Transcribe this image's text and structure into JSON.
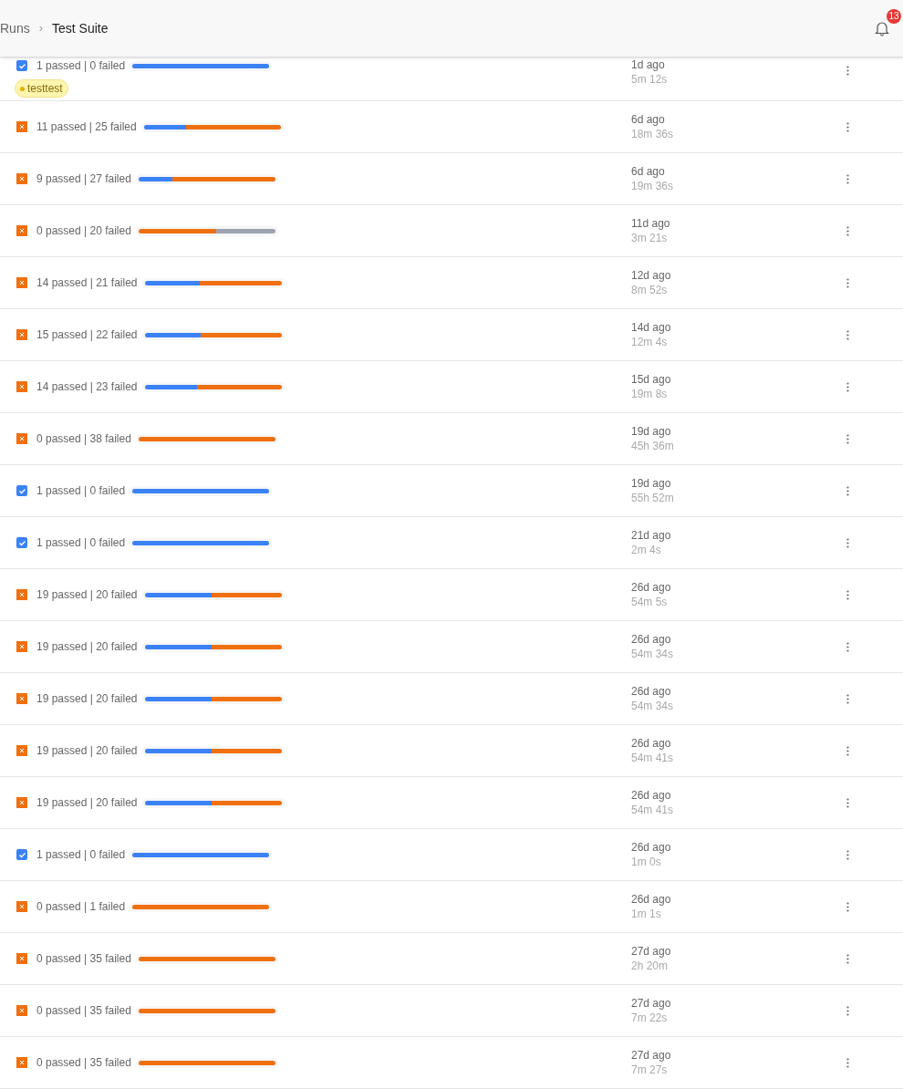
{
  "breadcrumb": {
    "parent": "Runs",
    "separator": "›",
    "current": "Test Suite"
  },
  "notifications": {
    "count": "13"
  },
  "runs": [
    {
      "passed": true,
      "summary": "1 passed | 0 failed",
      "bar": [
        {
          "kind": "passed",
          "level": 1
        }
      ],
      "tag": "testtest",
      "when": "1d ago",
      "duration": "5m 12s"
    },
    {
      "passed": false,
      "summary": "11 passed | 25 failed",
      "bar": [
        {
          "kind": "passed",
          "level": 0.31
        },
        {
          "kind": "failed",
          "level": 0.69
        }
      ],
      "when": "6d ago",
      "duration": "18m 36s"
    },
    {
      "passed": false,
      "summary": "9 passed | 27 failed",
      "bar": [
        {
          "kind": "passed",
          "level": 0.25
        },
        {
          "kind": "failed",
          "level": 0.75
        }
      ],
      "when": "6d ago",
      "duration": "19m 36s"
    },
    {
      "passed": false,
      "summary": "0 passed | 20 failed",
      "bar": [
        {
          "kind": "failed",
          "level": 0.57
        },
        {
          "kind": "other",
          "level": 0.43
        }
      ],
      "when": "11d ago",
      "duration": "3m 21s"
    },
    {
      "passed": false,
      "summary": "14 passed | 21 failed",
      "bar": [
        {
          "kind": "passed",
          "level": 0.4
        },
        {
          "kind": "failed",
          "level": 0.6
        }
      ],
      "when": "12d ago",
      "duration": "8m 52s"
    },
    {
      "passed": false,
      "summary": "15 passed | 22 failed",
      "bar": [
        {
          "kind": "passed",
          "level": 0.41
        },
        {
          "kind": "failed",
          "level": 0.59
        }
      ],
      "when": "14d ago",
      "duration": "12m 4s"
    },
    {
      "passed": false,
      "summary": "14 passed | 23 failed",
      "bar": [
        {
          "kind": "passed",
          "level": 0.38
        },
        {
          "kind": "failed",
          "level": 0.62
        }
      ],
      "when": "15d ago",
      "duration": "19m 8s"
    },
    {
      "passed": false,
      "summary": "0 passed | 38 failed",
      "bar": [
        {
          "kind": "failed",
          "level": 1
        }
      ],
      "when": "19d ago",
      "duration": "45h 36m"
    },
    {
      "passed": true,
      "summary": "1 passed | 0 failed",
      "bar": [
        {
          "kind": "passed",
          "level": 1
        }
      ],
      "when": "19d ago",
      "duration": "55h 52m"
    },
    {
      "passed": true,
      "summary": "1 passed | 0 failed",
      "bar": [
        {
          "kind": "passed",
          "level": 1
        }
      ],
      "when": "21d ago",
      "duration": "2m 4s"
    },
    {
      "passed": false,
      "summary": "19 passed | 20 failed",
      "bar": [
        {
          "kind": "passed",
          "level": 0.49
        },
        {
          "kind": "failed",
          "level": 0.51
        }
      ],
      "when": "26d ago",
      "duration": "54m 5s"
    },
    {
      "passed": false,
      "summary": "19 passed | 20 failed",
      "bar": [
        {
          "kind": "passed",
          "level": 0.49
        },
        {
          "kind": "failed",
          "level": 0.51
        }
      ],
      "when": "26d ago",
      "duration": "54m 34s"
    },
    {
      "passed": false,
      "summary": "19 passed | 20 failed",
      "bar": [
        {
          "kind": "passed",
          "level": 0.49
        },
        {
          "kind": "failed",
          "level": 0.51
        }
      ],
      "when": "26d ago",
      "duration": "54m 34s"
    },
    {
      "passed": false,
      "summary": "19 passed | 20 failed",
      "bar": [
        {
          "kind": "passed",
          "level": 0.49
        },
        {
          "kind": "failed",
          "level": 0.51
        }
      ],
      "when": "26d ago",
      "duration": "54m 41s"
    },
    {
      "passed": false,
      "summary": "19 passed | 20 failed",
      "bar": [
        {
          "kind": "passed",
          "level": 0.49
        },
        {
          "kind": "failed",
          "level": 0.51
        }
      ],
      "when": "26d ago",
      "duration": "54m 41s"
    },
    {
      "passed": true,
      "summary": "1 passed | 0 failed",
      "bar": [
        {
          "kind": "passed",
          "level": 1
        }
      ],
      "when": "26d ago",
      "duration": "1m 0s"
    },
    {
      "passed": false,
      "summary": "0 passed | 1 failed",
      "bar": [
        {
          "kind": "failed",
          "level": 1
        }
      ],
      "when": "26d ago",
      "duration": "1m 1s"
    },
    {
      "passed": false,
      "summary": "0 passed | 35 failed",
      "bar": [
        {
          "kind": "failed",
          "level": 1
        }
      ],
      "when": "27d ago",
      "duration": "2h 20m"
    },
    {
      "passed": false,
      "summary": "0 passed | 35 failed",
      "bar": [
        {
          "kind": "failed",
          "level": 1
        }
      ],
      "when": "27d ago",
      "duration": "7m 22s"
    },
    {
      "passed": false,
      "summary": "0 passed | 35 failed",
      "bar": [
        {
          "kind": "failed",
          "level": 1
        }
      ],
      "when": "27d ago",
      "duration": "7m 27s"
    }
  ]
}
